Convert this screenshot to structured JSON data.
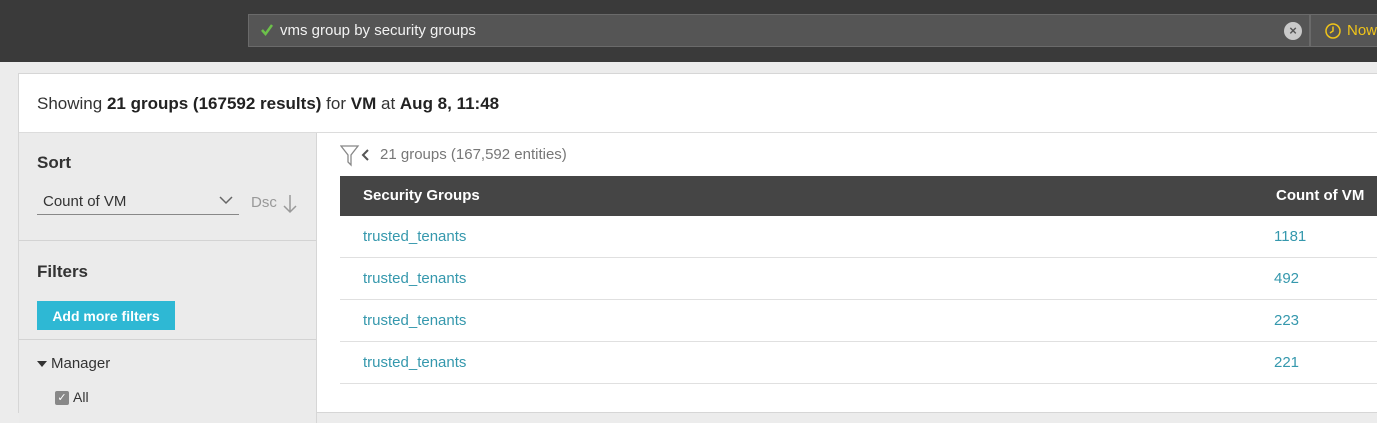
{
  "search": {
    "query": "vms group by security groups"
  },
  "time": {
    "label": "Now"
  },
  "summary": {
    "prefix": "Showing",
    "groups": "21 groups (167592 results)",
    "for": "for",
    "entity": "VM",
    "at": "at",
    "timestamp": "Aug 8, 11:48"
  },
  "sidebar": {
    "sort_title": "Sort",
    "sort_value": "Count of VM",
    "sort_order": "Dsc",
    "filters_title": "Filters",
    "add_filters": "Add more filters",
    "manager_label": "Manager",
    "all_label": "All"
  },
  "content": {
    "groups_count": "21 groups (167,592 entities)"
  },
  "table": {
    "columns": [
      "Security Groups",
      "Count of VM"
    ],
    "rows": [
      [
        "trusted_tenants",
        "1181"
      ],
      [
        "trusted_tenants",
        "492"
      ],
      [
        "trusted_tenants",
        "223"
      ],
      [
        "trusted_tenants",
        "221"
      ]
    ]
  },
  "colors": {
    "accent": "#2eb8d4",
    "link": "#3598ad",
    "header_bg": "#454545",
    "topbar_bg": "#3a3a3a",
    "time_text": "#f0c419"
  }
}
